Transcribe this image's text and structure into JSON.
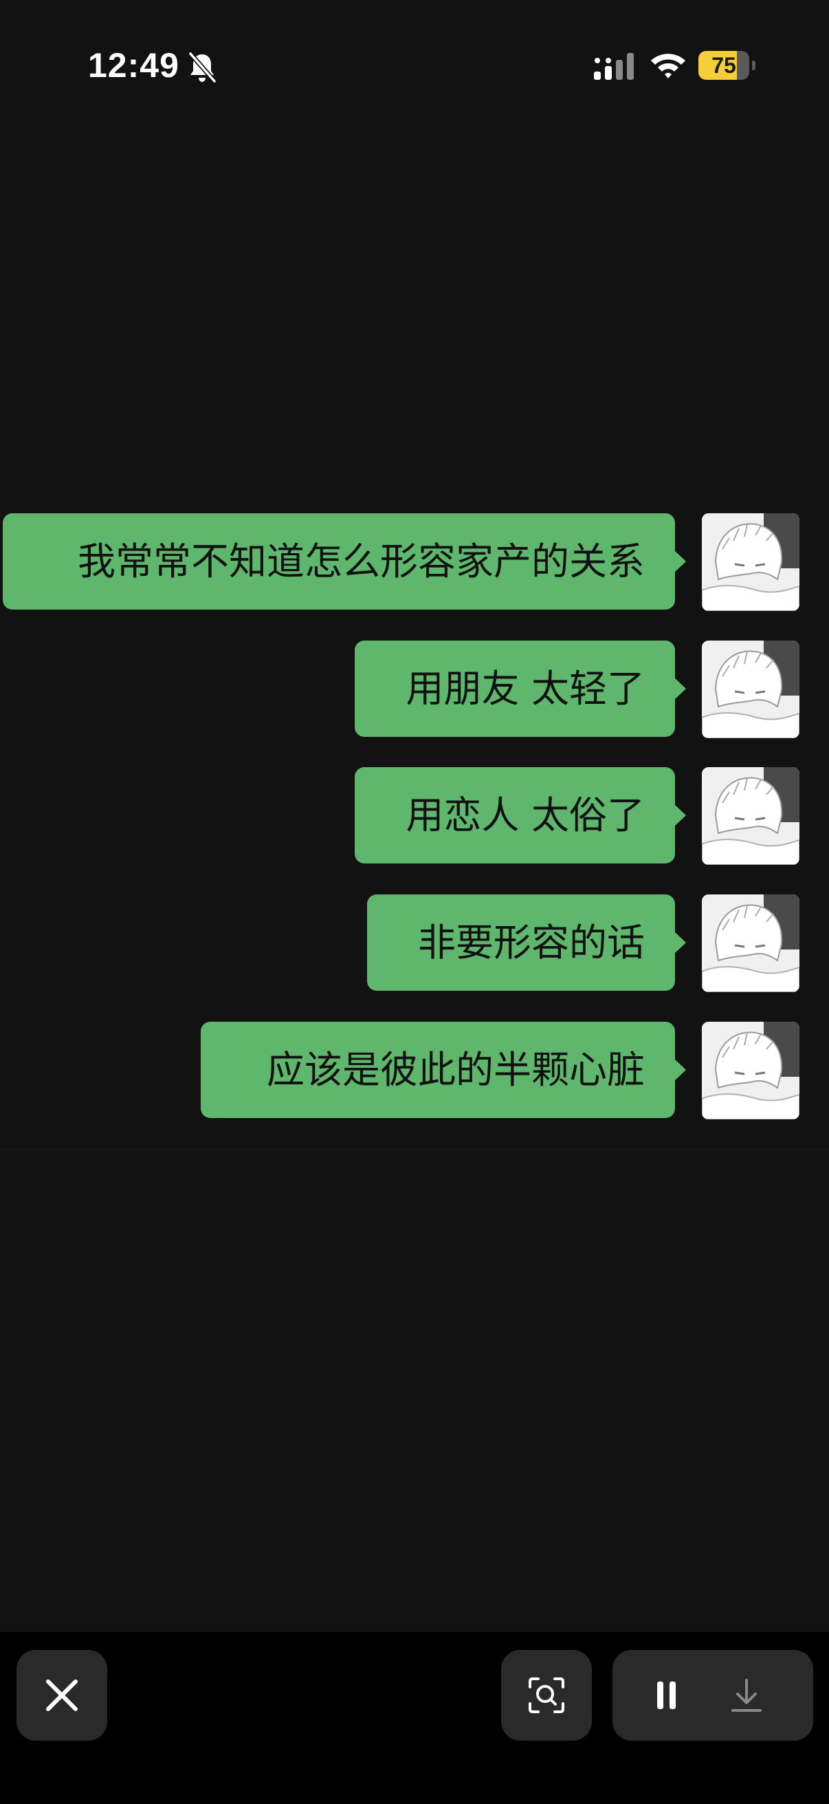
{
  "status_bar": {
    "time": "12:49",
    "battery_level": "75",
    "battery_fraction": 0.75,
    "icons": [
      "bell-muted-icon",
      "cellular-signal-icon",
      "wifi-icon",
      "battery-icon"
    ]
  },
  "chat": {
    "bubble_color": "#5fb76d",
    "messages": [
      {
        "text": "我常常不知道怎么形容家产的关系",
        "sender": "self"
      },
      {
        "text": "用朋友 太轻了",
        "sender": "self"
      },
      {
        "text": "用恋人 太俗了",
        "sender": "self"
      },
      {
        "text": "非要形容的话",
        "sender": "self"
      },
      {
        "text": "应该是彼此的半颗心脏",
        "sender": "self"
      }
    ]
  },
  "toolbar": {
    "buttons": [
      "close-icon",
      "visual-search-icon",
      "pause-icon",
      "download-icon"
    ]
  },
  "colors": {
    "background": "#121212",
    "toolbar_background": "#000000",
    "button_background": "#2a2a2a",
    "battery_accent": "#f4cf38"
  }
}
